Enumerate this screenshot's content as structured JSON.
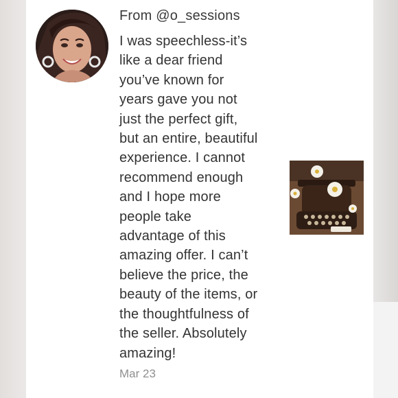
{
  "comment": {
    "author_prefix": "From",
    "author_handle": "@o_sessions",
    "body_lines": [
      "I was speechless-it’s",
      "like a dear friend",
      "you’ve known for",
      "years gave you not",
      "just the perfect gift,",
      "but an entire, beautiful",
      "experience. I cannot",
      "recommend enough",
      "and I hope more",
      "people take",
      "advantage of this",
      "amazing offer. I can’t",
      "believe the price, the",
      "beauty of the items, or",
      "the thoughtfulness of",
      "the seller. Absolutely",
      "amazing!"
    ],
    "date": "Mar 23"
  },
  "icons": {
    "avatar": "profile-photo",
    "thumbnail": "typewriter-with-flowers-photo"
  },
  "colors": {
    "text": "#333333",
    "date": "#8f8f8f",
    "card": "#ffffff",
    "background": "#e9e7e6"
  }
}
